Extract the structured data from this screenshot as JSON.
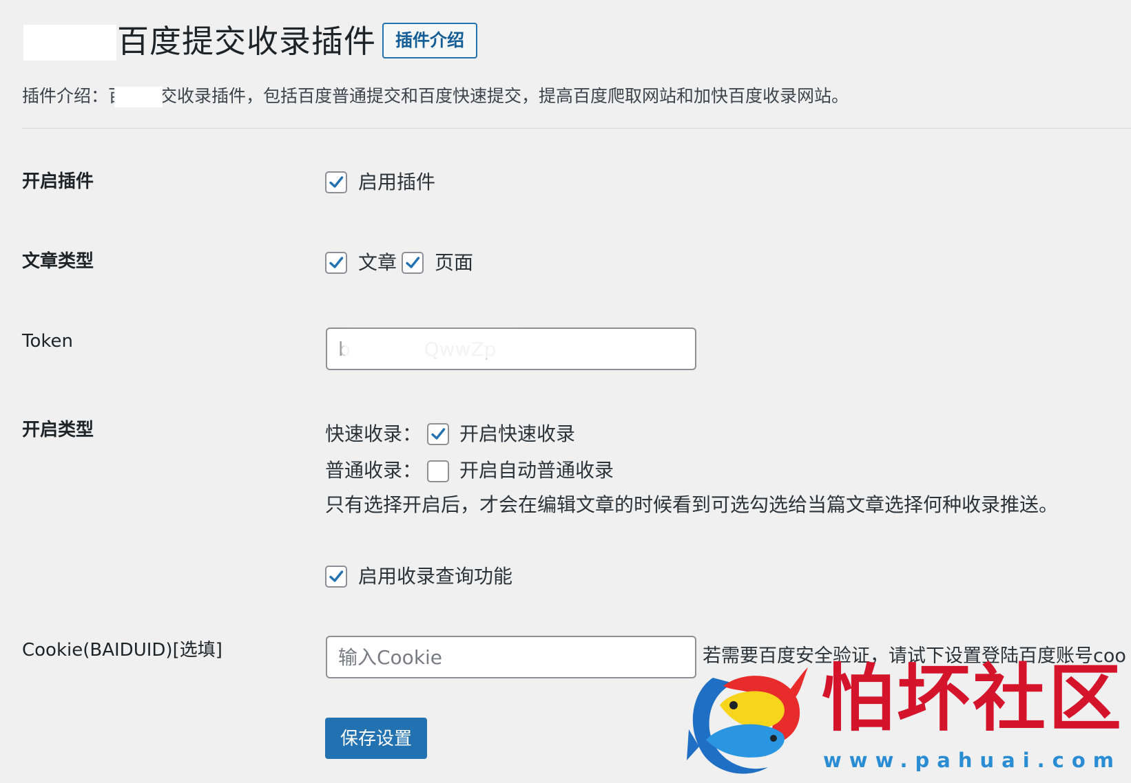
{
  "header": {
    "title": "百度提交收录插件",
    "intro_button": "插件介绍"
  },
  "description": "插件介绍：百度提交收录插件，包括百度普通提交和百度快速提交，提高百度爬取网站和加快百度收录网站。",
  "settings": {
    "enable_plugin": {
      "label": "开启插件",
      "option": "启用插件",
      "checked": true
    },
    "post_types": {
      "label": "文章类型",
      "options": [
        {
          "label": "文章",
          "checked": true
        },
        {
          "label": "页面",
          "checked": true
        }
      ]
    },
    "token": {
      "label": "Token",
      "value": "b            QwwZp"
    },
    "submit_types": {
      "label": "开启类型",
      "fast": {
        "prefix": "快速收录：",
        "option": "开启快速收录",
        "checked": true
      },
      "normal": {
        "prefix": "普通收录：",
        "option": "开启自动普通收录",
        "checked": false
      },
      "note": "只有选择开启后，才会在编辑文章的时候看到可选勾选给当篇文章选择何种收录推送。"
    },
    "query_feature": {
      "option": "启用收录查询功能",
      "checked": true
    },
    "cookie": {
      "label": "Cookie(BAIDUID)[选填]",
      "placeholder": "输入Cookie",
      "value": "",
      "note": "若需要百度安全验证，请试下设置登陆百度账号coo"
    }
  },
  "save_button": "保存设置",
  "watermark": {
    "title": "怕坏社区",
    "url": "www.pahuai.com"
  },
  "colors": {
    "background": "#f0f0f1",
    "accent": "#2271b1",
    "watermark_red": "#d4142b",
    "watermark_blue": "#2a8dd4"
  }
}
